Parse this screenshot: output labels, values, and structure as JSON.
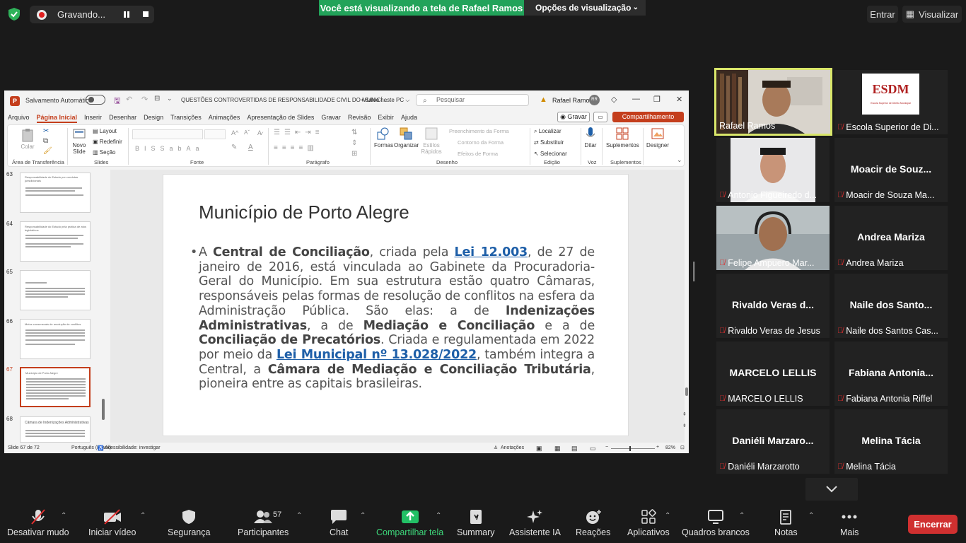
{
  "topbar": {
    "recording_label": "Gravando...",
    "share_banner": "Você está visualizando a tela de Rafael Ramos",
    "view_options": "Opções de visualização",
    "entrar": "Entrar",
    "visualizar": "Visualizar"
  },
  "ppt": {
    "autosave": "Salvamento Automático",
    "doc_title": "QUESTÕES CONTROVERTIDAS DE RESPONSABILIDADE CIVIL DO MUNICÍ...",
    "saved": "• Salvo neste PC ⌵",
    "search_placeholder": "Pesquisar",
    "user": "Rafael Ramos",
    "user_initials": "RR",
    "menu": [
      "Arquivo",
      "Página Inicial",
      "Inserir",
      "Desenhar",
      "Design",
      "Transições",
      "Animações",
      "Apresentação de Slides",
      "Gravar",
      "Revisão",
      "Exibir",
      "Ajuda"
    ],
    "gravar": "Gravar",
    "compartilhamento": "Compartilhamento",
    "ribbon": {
      "colar": "Colar",
      "area_transf": "Área de Transferência",
      "novo_slide": "Novo Slide",
      "layout": "Layout",
      "redefinir": "Redefinir",
      "secao": "Seção",
      "slides": "Slides",
      "fonte": "Fonte",
      "paragrafo": "Parágrafo",
      "formas": "Formas",
      "organizar": "Organizar",
      "estilos_rapidos": "Estilos Rápidos",
      "preench": "Preenchimento da Forma",
      "contorno": "Contorno da Forma",
      "efeitos": "Efeitos de Forma",
      "desenho": "Desenho",
      "localizar": "Localizar",
      "substituir": "Substituir",
      "selecionar": "Selecionar",
      "edicao": "Edição",
      "ditar": "Ditar",
      "voz": "Voz",
      "suplementos": "Suplementos",
      "designer": "Designer"
    },
    "thumbs": [
      {
        "num": "63",
        "title": "Responsabilidade do Estado por condutas jurisdicionais"
      },
      {
        "num": "64",
        "title": "Responsabilidade do Estado pela prática de atos legislativos"
      },
      {
        "num": "65",
        "title": ""
      },
      {
        "num": "66",
        "title": "Meios consensuais de resolução de conflitos"
      },
      {
        "num": "67",
        "title": "Município de Porto Alegre"
      },
      {
        "num": "68",
        "title": "Câmara de Indenizações Administrativas"
      }
    ],
    "slide": {
      "title": "Município de Porto Alegre",
      "p1": "A ",
      "b1": "Central de Conciliação",
      "p2": ", criada pela ",
      "l1": "Lei 12.003",
      "p3": ", de 27 de janeiro de 2016, está vinculada ao Gabinete da Procuradoria-Geral do Município. Em sua estrutura estão quatro Câmaras, responsáveis pelas formas de resolução de conflitos na esfera da Administração Pública. São elas: a de ",
      "b2": "Indenizações Administrativas",
      "p4": ", a de ",
      "b3": "Mediação e Conciliação",
      "p5": " e a de ",
      "b4": "Conciliação de Precatórios",
      "p6": ". Criada e regulamentada em 2022 por meio da ",
      "l2": "Lei Municipal nº 13.028/2022",
      "p7": ", também integra a Central, a ",
      "b5": "Câmara de Mediação e Conciliação Tributária",
      "p8": ", pioneira entre as capitais brasileiras."
    },
    "status": {
      "slide_of": "Slide 67 de 72",
      "lang": "Português (Brasil)",
      "access": "Acessibilidade: investigar",
      "notes": "Anotações",
      "zoom": "82%"
    }
  },
  "participants": [
    {
      "big": "",
      "label": "Rafael Ramos",
      "muted": false,
      "video": "rafael"
    },
    {
      "big": "",
      "label": "Escola Superior de Di...",
      "muted": true,
      "video": "esdm"
    },
    {
      "big": "",
      "label": "Antonio Figueiredo d...",
      "muted": true,
      "video": "antonio"
    },
    {
      "big": "Moacir de Souz...",
      "label": "Moacir de Souza Ma...",
      "muted": true,
      "video": ""
    },
    {
      "big": "",
      "label": "Felipe Ampuero Mar...",
      "muted": true,
      "video": "felipe"
    },
    {
      "big": "Andrea Mariza",
      "label": "Andrea Mariza",
      "muted": true,
      "video": ""
    },
    {
      "big": "Rivaldo Veras d...",
      "label": "Rivaldo Veras de Jesus",
      "muted": true,
      "video": ""
    },
    {
      "big": "Naile dos Santo...",
      "label": "Naile dos Santos Cas...",
      "muted": true,
      "video": ""
    },
    {
      "big": "MARCELO LELLIS",
      "label": "MARCELO LELLIS",
      "muted": true,
      "video": ""
    },
    {
      "big": "Fabiana Antonia...",
      "label": "Fabiana Antonia Riffel",
      "muted": true,
      "video": ""
    },
    {
      "big": "Daniéli Marzaro...",
      "label": "Daniéli Marzarotto",
      "muted": true,
      "video": ""
    },
    {
      "big": "Melina Tácia",
      "label": "Melina Tácia",
      "muted": true,
      "video": ""
    }
  ],
  "esdm_logo": "ESDM",
  "esdm_sub": "Escola Superior de Direito Municipal",
  "toolbar": {
    "mute": "Desativar mudo",
    "video": "Iniciar vídeo",
    "security": "Segurança",
    "participants": "Participantes",
    "participants_count": "57",
    "chat": "Chat",
    "share": "Compartilhar tela",
    "summary": "Summary",
    "ai": "Assistente IA",
    "reactions": "Reações",
    "apps": "Aplicativos",
    "whiteboards": "Quadros brancos",
    "notes": "Notas",
    "more": "Mais",
    "end": "Encerrar"
  },
  "colors": {
    "share_green": "#22a35a",
    "ppt_accent": "#c43e1c",
    "active_border": "#d9e66a",
    "end_red": "#d03030"
  }
}
